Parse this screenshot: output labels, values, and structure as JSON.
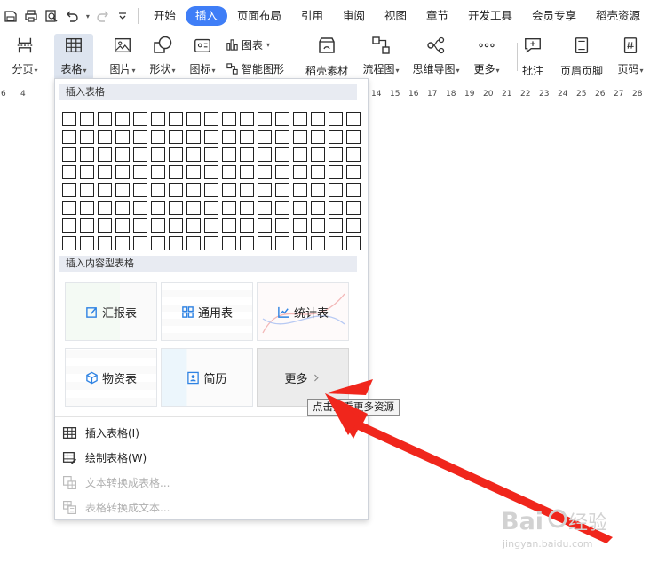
{
  "tabs": [
    "开始",
    "插入",
    "页面布局",
    "引用",
    "审阅",
    "视图",
    "章节",
    "开发工具",
    "会员专享",
    "稻壳资源"
  ],
  "active_tab": "插入",
  "ribbon": {
    "page_break": "分页",
    "table": "表格",
    "picture": "图片",
    "shape": "形状",
    "icon": "图标",
    "chart": "图表",
    "smart_graphic": "智能图形",
    "docer_material": "稻壳素材",
    "flowchart": "流程图",
    "mindmap": "思维导图",
    "more": "更多",
    "comment": "批注",
    "header_footer": "页眉页脚",
    "page_number": "页码"
  },
  "ruler": {
    "left_ticks": [
      "6",
      "4"
    ],
    "right_ticks": [
      "14",
      "15",
      "16",
      "17",
      "18",
      "19",
      "20",
      "21",
      "22",
      "23",
      "24",
      "25",
      "26",
      "27",
      "28"
    ]
  },
  "dropdown": {
    "insert_table_header": "插入表格",
    "grid_cols": 17,
    "grid_rows": 8,
    "content_table_header": "插入内容型表格",
    "cards": [
      {
        "name": "report",
        "label": "汇报表",
        "icon": "edit-icon"
      },
      {
        "name": "general",
        "label": "通用表",
        "icon": "grid-icon"
      },
      {
        "name": "stats",
        "label": "统计表",
        "icon": "chart-icon"
      },
      {
        "name": "materials",
        "label": "物资表",
        "icon": "cube-icon"
      },
      {
        "name": "resume",
        "label": "简历",
        "icon": "id-card-icon"
      },
      {
        "name": "more",
        "label": "更多",
        "icon": "chevron-right-icon"
      }
    ],
    "menu": [
      {
        "label": "插入表格(I)",
        "enabled": true,
        "icon": "table-icon"
      },
      {
        "label": "绘制表格(W)",
        "enabled": true,
        "icon": "pencil-table-icon"
      },
      {
        "label": "文本转换成表格...",
        "enabled": false,
        "icon": "text-to-table-icon"
      },
      {
        "label": "表格转换成文本...",
        "enabled": false,
        "icon": "table-to-text-icon"
      }
    ]
  },
  "tooltip": "点击查看更多资源",
  "colors": {
    "accent": "#3f7ef7",
    "arrow": "#f0261c",
    "icon_blue": "#2f83e3"
  }
}
